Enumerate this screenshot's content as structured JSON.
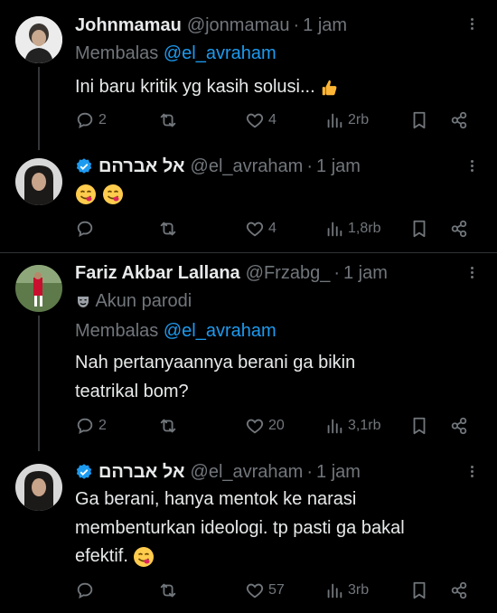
{
  "colors": {
    "background": "#000000",
    "text": "#e7e9ea",
    "muted": "#71767b",
    "link": "#1d9bf0",
    "verified": "#1d9bf0"
  },
  "tweets": [
    {
      "name": "Johnmamau",
      "handle": "@jonmamau",
      "time": "1 jam",
      "reply_prefix": "Membalas",
      "reply_to": "@el_avraham",
      "text_lines": [
        "Ini baru kritik yg kasih solusi..."
      ],
      "emoji": "thumbs-up",
      "replies": "2",
      "retweets": "",
      "likes": "4",
      "views": "2rb"
    },
    {
      "name": "אל אברהם",
      "handle": "@el_avraham",
      "time": "1 jam",
      "verified": true,
      "emoji": "yum-face x2",
      "replies": "",
      "retweets": "",
      "likes": "4",
      "views": "1,8rb"
    },
    {
      "name": "Fariz Akbar Lallana",
      "handle": "@Frzabg_",
      "time": "1 jam",
      "label": "Akun parodi",
      "reply_prefix": "Membalas",
      "reply_to": "@el_avraham",
      "text_lines": [
        "Nah pertanyaannya berani ga bikin",
        "teatrikal bom?"
      ],
      "replies": "2",
      "retweets": "",
      "likes": "20",
      "views": "3,1rb"
    },
    {
      "name": "אל אברהם",
      "handle": "@el_avraham",
      "time": "1 jam",
      "verified": true,
      "text_lines": [
        "Ga berani, hanya mentok ke narasi",
        "membenturkan ideologi. tp pasti ga bakal",
        "efektif."
      ],
      "emoji": "yum-face",
      "replies": "",
      "retweets": "",
      "likes": "57",
      "views": "3rb"
    }
  ],
  "icons": [
    "reply-icon",
    "retweet-icon",
    "like-icon",
    "views-icon",
    "bookmark-icon",
    "share-icon",
    "verified-icon",
    "more-icon",
    "theater-mask-icon"
  ],
  "separator": "·"
}
